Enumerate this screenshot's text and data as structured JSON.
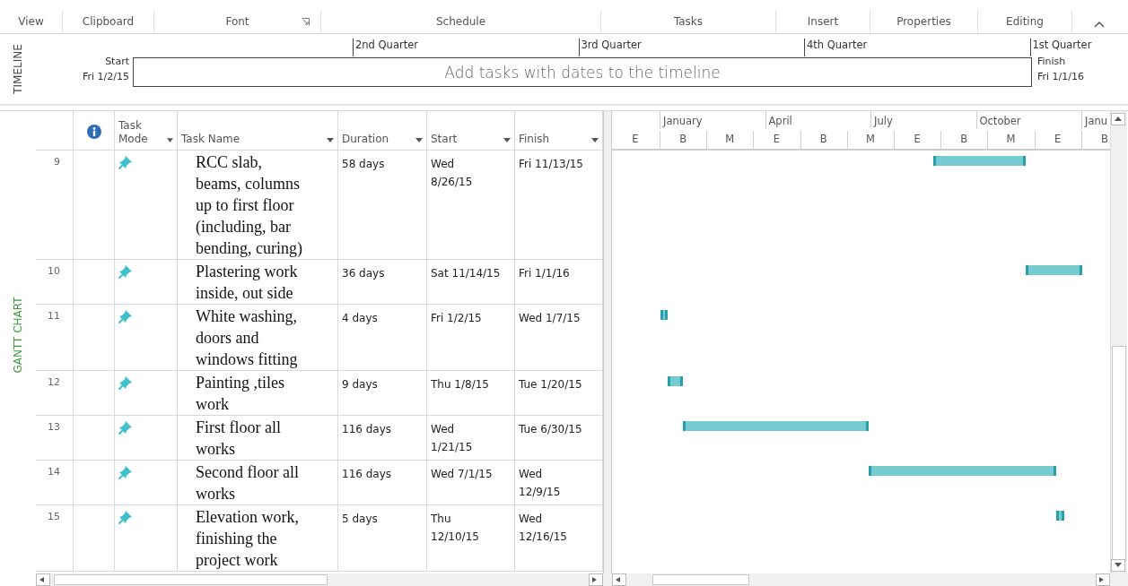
{
  "ribbon_groups": [
    {
      "label": "View",
      "launcher": false
    },
    {
      "label": "Clipboard",
      "launcher": false
    },
    {
      "label": "Font",
      "launcher": true
    },
    {
      "label": "Schedule",
      "launcher": false
    },
    {
      "label": "Tasks",
      "launcher": false
    },
    {
      "label": "Insert",
      "launcher": false
    },
    {
      "label": "Properties",
      "launcher": false
    },
    {
      "label": "Editing",
      "launcher": false
    }
  ],
  "timeline": {
    "side_label": "TIMELINE",
    "start_label": "Start",
    "start_date": "Fri 1/2/15",
    "finish_label": "Finish",
    "finish_date": "Fri 1/1/16",
    "placeholder": "Add tasks with dates to the timeline",
    "quarters": [
      "2nd Quarter",
      "3rd Quarter",
      "4th Quarter",
      "1st Quarter"
    ]
  },
  "view_label": "GANTT CHART",
  "table": {
    "columns": [
      {
        "kind": "info"
      },
      {
        "kind": "text",
        "label": "Task Mode",
        "filter": true
      },
      {
        "kind": "text",
        "label": "Task Name",
        "filter": true
      },
      {
        "kind": "text",
        "label": "Duration",
        "filter": true
      },
      {
        "kind": "text",
        "label": "Start",
        "filter": true
      },
      {
        "kind": "text",
        "label": "Finish",
        "filter": true
      }
    ],
    "rows": [
      {
        "id": "9",
        "kind": "manual",
        "name": "RCC slab,\nbeams, columns\nup to first floor\n(including, bar\nbending, curing)",
        "duration": "58 days",
        "start": "Wed\n8/26/15",
        "finish": "Fri 11/13/15"
      },
      {
        "id": "10",
        "kind": "manual",
        "name": "Plastering work\ninside, out side",
        "duration": "36 days",
        "start": "Sat 11/14/15",
        "finish": "Fri 1/1/16"
      },
      {
        "id": "11",
        "kind": "manual",
        "name": "White washing,\ndoors and\nwindows fitting",
        "duration": "4 days",
        "start": "Fri 1/2/15",
        "finish": "Wed 1/7/15"
      },
      {
        "id": "12",
        "kind": "manual",
        "name": "Painting ,tiles\nwork",
        "duration": "9 days",
        "start": "Thu 1/8/15",
        "finish": "Tue 1/20/15"
      },
      {
        "id": "13",
        "kind": "manual",
        "name": "First floor all\nworks",
        "duration": "116 days",
        "start": "Wed\n1/21/15",
        "finish": "Tue 6/30/15"
      },
      {
        "id": "14",
        "kind": "manual",
        "name": "Second floor all\nworks",
        "duration": "116 days",
        "start": "Wed 7/1/15",
        "finish": "Wed\n12/9/15"
      },
      {
        "id": "15",
        "kind": "manual",
        "name": "Elevation work,\nfinishing the\nproject work",
        "duration": "5 days",
        "start": "Thu\n12/10/15",
        "finish": "Wed\n12/16/15"
      }
    ]
  },
  "gantt": {
    "timescale_top": [
      "January",
      "April",
      "July",
      "October",
      "Janu"
    ],
    "timescale_bottom": [
      "E",
      "B",
      "M",
      "E",
      "B",
      "M",
      "E",
      "B",
      "M",
      "E",
      "B"
    ]
  }
}
